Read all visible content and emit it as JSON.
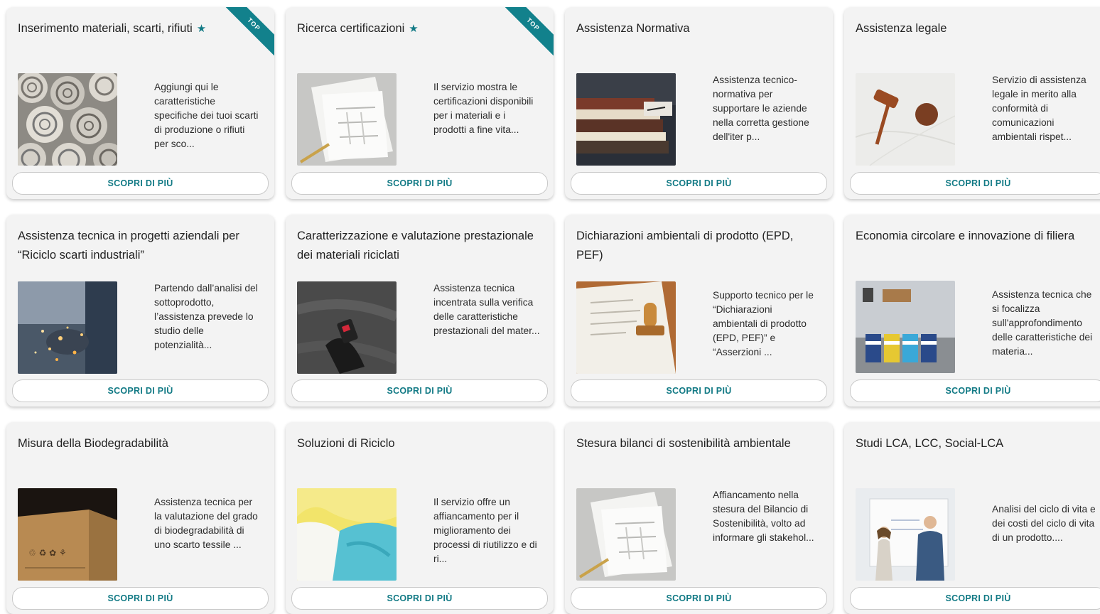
{
  "cta_label": "SCOPRI DI PIÙ",
  "top_badge": "TOP",
  "accent": "#127a85",
  "cards": [
    {
      "title": "Inserimento materiali, scarti, rifiuti",
      "featured": true,
      "image": "fabric-rolls-photo",
      "desc": "Aggiungi qui le caratteristiche specifiche dei tuoi scarti di produzione o rifiuti per sco..."
    },
    {
      "title": "Ricerca certificazioni",
      "featured": true,
      "image": "documents-photo",
      "desc": "Il servizio mostra le certificazioni disponibili per i materiali e i prodotti a fine vita..."
    },
    {
      "title": "Assistenza Normativa",
      "featured": false,
      "image": "books-photo",
      "desc": "Assistenza tecnico-normativa per supportare le aziende nella corretta gestione dell'iter p..."
    },
    {
      "title": "Assistenza legale",
      "featured": false,
      "image": "gavel-photo",
      "desc": "Servizio di assistenza legale in merito alla conformità di comunicazioni ambientali rispet..."
    },
    {
      "title": "Assistenza tecnica in progetti aziendali per “Riciclo scarti industriali”",
      "featured": false,
      "image": "grinding-sparks-photo",
      "desc": "Partendo dall’analisi del sottoprodotto, l’assistenza prevede lo studio delle potenzialità..."
    },
    {
      "title": "Caratterizzazione e valutazione prestazionale dei materiali riciclati",
      "featured": false,
      "image": "seat-belt-photo",
      "desc": "Assistenza tecnica incentrata sulla verifica delle caratteristiche prestazionali del mater..."
    },
    {
      "title": "Dichiarazioni ambientali di prodotto (EPD, PEF)",
      "featured": false,
      "image": "stamp-photo",
      "desc": "Supporto tecnico per le “Dichiarazioni ambientali di prodotto (EPD, PEF)” e “Asserzioni ..."
    },
    {
      "title": "Economia circolare e innovazione di filiera",
      "featured": false,
      "image": "recycling-bins-photo",
      "desc": "Assistenza tecnica che si focalizza sull'approfondimento delle caratteristiche dei materia..."
    },
    {
      "title": "Misura della Biodegradabilità",
      "featured": false,
      "image": "cardboard-box-photo",
      "desc": "Assistenza tecnica per la valutazione del grado di biodegradabilità di uno scarto tessile ..."
    },
    {
      "title": "Soluzioni di Riciclo",
      "featured": false,
      "image": "colored-fabrics-photo",
      "desc": "Il servizio offre un affiancamento per il miglioramento dei processi di riutilizzo e di ri..."
    },
    {
      "title": "Stesura bilanci di sostenibilità ambientale",
      "featured": false,
      "image": "documents-photo",
      "desc": "Affiancamento nella stesura del Bilancio di Sostenibilità, volto ad informare gli stakehol..."
    },
    {
      "title": "Studi LCA, LCC, Social-LCA",
      "featured": false,
      "image": "whiteboard-meeting-photo",
      "desc": "Analisi del ciclo di vita e dei costi del ciclo di vita di un prodotto...."
    }
  ]
}
